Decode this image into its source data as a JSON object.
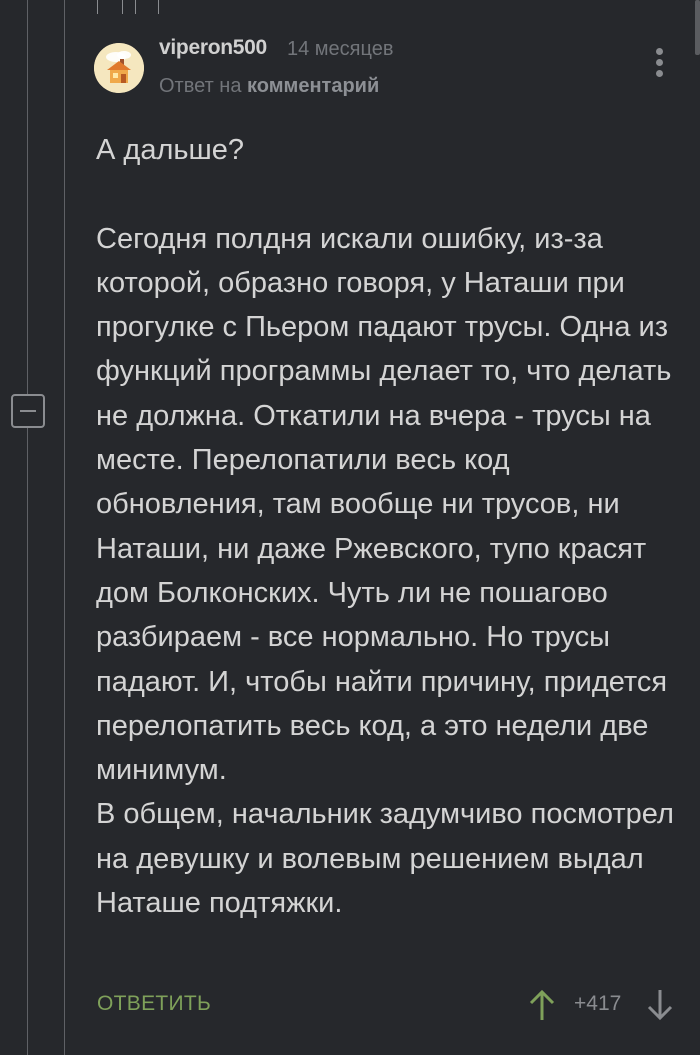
{
  "comment": {
    "author": "viperon500",
    "timestamp": "14 месяцев",
    "reply_prefix": "Ответ на",
    "reply_target": "комментарий",
    "paragraphs": [
      "А дальше?",
      "Сегодня полдня искали ошибку, из-за которой, образно говоря, у Наташи при прогулке с Пьером падают трусы. Одна из функций программы делает то, что делать не должна. Откатили на вчера - трусы на месте. Перелопатили весь код обновления, там вообще ни трусов, ни Наташи, ни даже Ржевского, тупо красят дом Болконских. Чуть ли не пошагово разбираем - все нормально. Но трусы падают. И, чтобы найти причину, придется перелопатить весь код, а это недели две минимум.",
      "В общем, начальник задумчиво посмотрел на девушку и волевым решением выдал Наташе подтяжки."
    ]
  },
  "footer": {
    "reply_label": "ОТВЕТИТЬ",
    "rating": "+417"
  },
  "colors": {
    "background": "#26282c",
    "reply_accent": "#7fa15a",
    "vote_up": "#7fa15a",
    "muted": "#72757a"
  },
  "icons": {
    "avatar": "house-avatar-icon",
    "menu": "more-vertical-icon",
    "collapse": "minus-square-icon",
    "vote_up": "arrow-up-icon",
    "vote_down": "arrow-down-icon"
  }
}
